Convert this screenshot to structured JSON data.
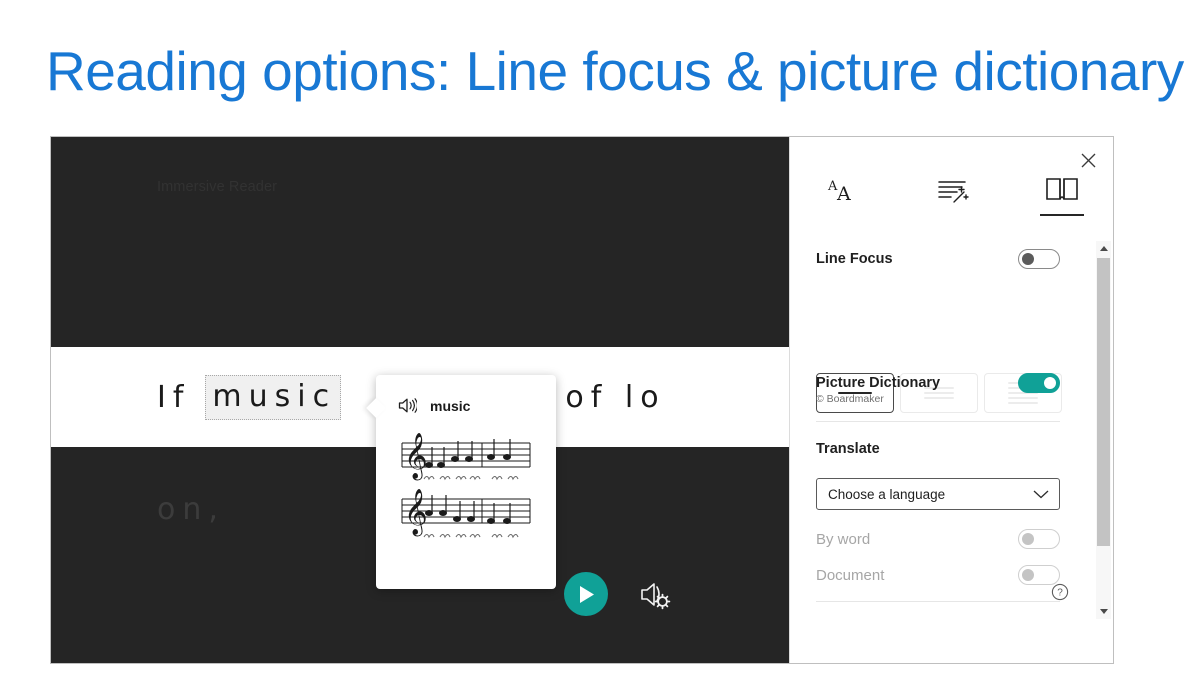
{
  "slide": {
    "title": "Reading options: Line focus & picture dictionary",
    "title_color": "#1878d4"
  },
  "reader": {
    "document_title": "Immersive Reader",
    "focused_line": {
      "before_word": "If",
      "highlighted_word": "music",
      "after_word_visible": "ood of lo"
    },
    "dimmed_line": "on,",
    "play_button_label": "Play",
    "voice_settings_label": "Voice settings"
  },
  "picture_dictionary_popup": {
    "speaker_icon": "speaker-icon",
    "word": "music",
    "image_alt": "sheet music illustration"
  },
  "panel": {
    "close_label": "Close",
    "tabs": [
      {
        "label": "Text Preferences",
        "icon": "text-size-icon",
        "selected": false
      },
      {
        "label": "Grammar Options",
        "icon": "grammar-wand-icon",
        "selected": false
      },
      {
        "label": "Reading Preferences",
        "icon": "open-book-icon",
        "selected": true
      }
    ],
    "line_focus": {
      "label": "Line Focus",
      "toggle_state": "off",
      "options": [
        {
          "name": "one-line",
          "lines": 1,
          "selected": true
        },
        {
          "name": "three-lines",
          "lines": 3,
          "selected": false
        },
        {
          "name": "five-lines",
          "lines": 5,
          "selected": false
        }
      ]
    },
    "picture_dictionary": {
      "label": "Picture Dictionary",
      "sublabel": "© Boardmaker",
      "toggle_state": "on",
      "toggle_color": "#10a197"
    },
    "translate": {
      "label": "Translate",
      "language_select_value": "Choose a language",
      "chevron_icon": "chevron-down-icon",
      "by_word": {
        "label": "By word",
        "toggle_state": "off",
        "disabled": true
      },
      "document": {
        "label": "Document",
        "toggle_state": "off",
        "disabled": true
      }
    },
    "help_icon": "help-circle-icon",
    "scrollbar": {
      "up_icon": "caret-up-icon",
      "down_icon": "caret-down-icon"
    }
  }
}
